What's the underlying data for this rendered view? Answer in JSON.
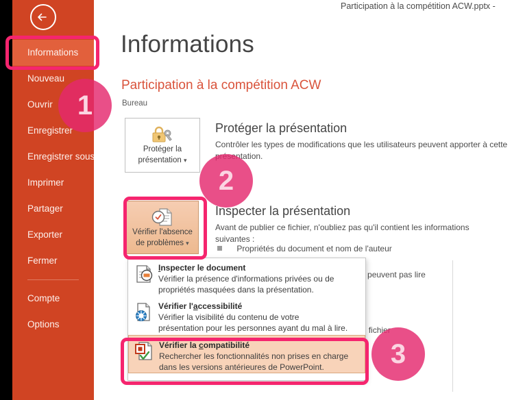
{
  "window": {
    "title": "Participation à la compétition ACW.pptx -"
  },
  "sidebar": {
    "back_icon": "back-arrow-icon",
    "items": [
      {
        "label": "Informations",
        "active": true
      },
      {
        "label": "Nouveau",
        "active": false
      },
      {
        "label": "Ouvrir",
        "active": false
      },
      {
        "label": "Enregistrer",
        "active": false
      },
      {
        "label": "Enregistrer sous",
        "active": false
      },
      {
        "label": "Imprimer",
        "active": false
      },
      {
        "label": "Partager",
        "active": false
      },
      {
        "label": "Exporter",
        "active": false
      },
      {
        "label": "Fermer",
        "active": false
      }
    ],
    "footer_items": [
      {
        "label": "Compte"
      },
      {
        "label": "Options"
      }
    ]
  },
  "main": {
    "page_title": "Informations",
    "document_title": "Participation à la compétition ACW",
    "document_location": "Bureau",
    "protect": {
      "button_label_line1": "Protéger la",
      "button_label_line2": "présentation",
      "button_caret": "▾",
      "icon": "lock-key-icon",
      "heading": "Protéger la présentation",
      "body": "Contrôler les types de modifications que les utilisateurs peuvent apporter à cette présentation."
    },
    "inspect": {
      "button_label_line1": "Vérifier l'absence",
      "button_label_line2": "de problèmes",
      "button_caret": "▾",
      "icon": "inspect-document-icon",
      "heading": "Inspecter la présentation",
      "body": "Avant de publier ce fichier, n'oubliez pas qu'il contient les informations suivantes :",
      "bullet": "Propriétés du document et nom de l'auteur"
    },
    "background_text": {
      "line1": "pées ne peuvent pas lire",
      "line2": "e de ce fichier"
    }
  },
  "dropdown": {
    "items": [
      {
        "icon": "inspect-document-icon",
        "title_pre": "",
        "title_underline": "I",
        "title_post": "nspecter le document",
        "desc_line1": "Vérifier la présence d'informations privées ou de",
        "desc_line2": "propriétés masquées dans la présentation.",
        "selected": false
      },
      {
        "icon": "accessibility-icon",
        "title_pre": "Vérifier l'",
        "title_underline": "a",
        "title_post": "ccessibilité",
        "desc_line1": "Vérifier la visibilité du contenu de votre",
        "desc_line2": "présentation pour les personnes ayant du mal à lire.",
        "selected": false
      },
      {
        "icon": "compatibility-check-icon",
        "title_pre": "Vérifier la ",
        "title_underline": "c",
        "title_post": "ompatibilité",
        "desc_line1": "Rechercher les fonctionnalités non prises en charge",
        "desc_line2": "dans les versions antérieures de PowerPoint.",
        "selected": true
      }
    ]
  },
  "annotations": {
    "highlight_color": "#f5256e",
    "circle_color": "#e4286e",
    "circles": [
      {
        "number": "1"
      },
      {
        "number": "2"
      },
      {
        "number": "3"
      }
    ]
  },
  "colors": {
    "sidebar_bg": "#d04423",
    "sidebar_active": "#e2603c",
    "accent_title": "#d9533b",
    "selected_item_bg": "#f8d3b9"
  }
}
